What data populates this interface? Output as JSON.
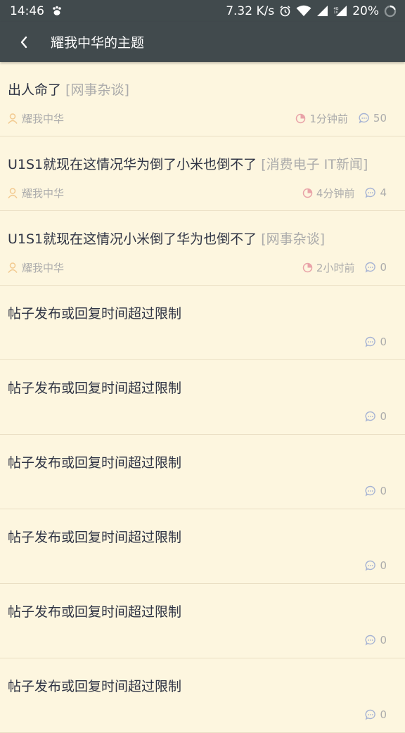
{
  "status_bar": {
    "time": "14:46",
    "speed": "7.32 K/s",
    "battery": "20%",
    "icons": [
      "paw-icon",
      "alarm-icon",
      "wifi-icon",
      "signal-icon",
      "signal-4g-icon",
      "battery-ring-icon"
    ]
  },
  "header": {
    "title": "耀我中华的主题",
    "back_icon": "back-arrow-icon"
  },
  "colors": {
    "background": "#fdf6df",
    "appbar": "#414a4d",
    "author_icon": "#f2c98f",
    "time_icon": "#e9a3a8",
    "comment_icon": "#a6b3d4"
  },
  "posts": [
    {
      "title": "出人命了",
      "tag": "[网事杂谈]",
      "author": "耀我中华",
      "time": "1分钟前",
      "comments": "50"
    },
    {
      "title": "U1S1就现在这情况华为倒了小米也倒不了",
      "tag": "[消费电子 IT新闻]",
      "author": "耀我中华",
      "time": "4分钟前",
      "comments": "4"
    },
    {
      "title": "U1S1就现在这情况小米倒了华为也倒不了",
      "tag": "[网事杂谈]",
      "author": "耀我中华",
      "time": "2小时前",
      "comments": "0"
    },
    {
      "title": "帖子发布或回复时间超过限制",
      "tag": "",
      "author": "",
      "time": "",
      "comments": "0"
    },
    {
      "title": "帖子发布或回复时间超过限制",
      "tag": "",
      "author": "",
      "time": "",
      "comments": "0"
    },
    {
      "title": "帖子发布或回复时间超过限制",
      "tag": "",
      "author": "",
      "time": "",
      "comments": "0"
    },
    {
      "title": "帖子发布或回复时间超过限制",
      "tag": "",
      "author": "",
      "time": "",
      "comments": "0"
    },
    {
      "title": "帖子发布或回复时间超过限制",
      "tag": "",
      "author": "",
      "time": "",
      "comments": "0"
    },
    {
      "title": "帖子发布或回复时间超过限制",
      "tag": "",
      "author": "",
      "time": "",
      "comments": "0"
    }
  ]
}
